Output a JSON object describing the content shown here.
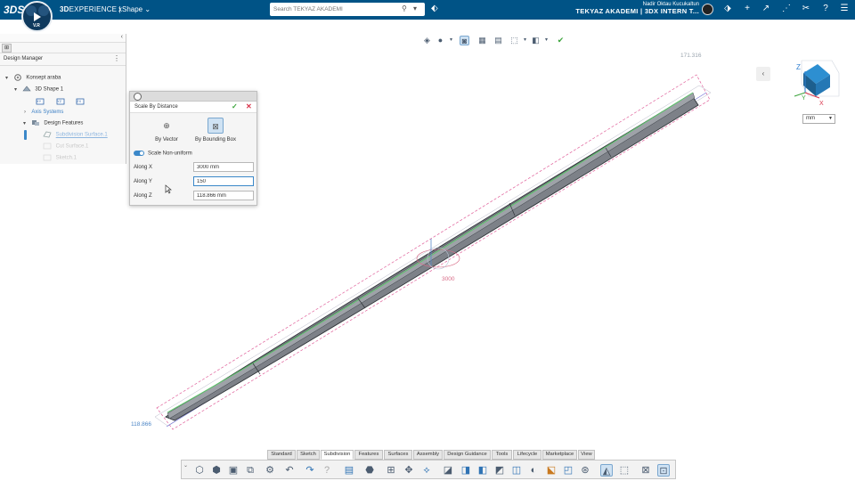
{
  "topbar": {
    "logo": "3DS",
    "brand_bold": "3D",
    "brand_rest": "EXPERIENCE",
    "app_separator": "|",
    "app_name": "xShape",
    "app_chevron": "⌄",
    "compass_version": "V.R",
    "search_placeholder": "Search TEKYAZ AKADEMI",
    "user_name": "Nadir Oktau Kucukaltun",
    "collab_space": "TEKYAZ AKADEMI | 3DX INTERN T...",
    "icons": [
      "tag-icon",
      "share-icon",
      "add-icon",
      "forward-icon",
      "network-icon",
      "tools-icon",
      "help-icon",
      "menu-icon"
    ]
  },
  "tree": {
    "collapse_glyph": "‹",
    "tab_glyph": "⊞",
    "header": "Design Manager",
    "more_glyph": "⋮",
    "nodes": [
      {
        "label": "Konsept araba",
        "caret": "▾"
      },
      {
        "label": "3D Shape 1",
        "caret": "▾"
      },
      {
        "label": "Axis Systems",
        "caret": "›"
      },
      {
        "label": "Design Features",
        "caret": "▾"
      },
      {
        "label": "Subdivision Surface.1",
        "caret": ""
      },
      {
        "label": "Cut Surface.1",
        "caret": ""
      },
      {
        "label": "Sketch.1",
        "caret": ""
      }
    ],
    "planes": [
      "XY",
      "YZ",
      "ZX"
    ]
  },
  "viewport": {
    "dim_top": "171.316",
    "dim_bottom": "118.866",
    "dim_mid": "3000",
    "unit": "mm",
    "unit_dd": "▼",
    "side_toggle_glyph": "‹",
    "quick_icons": [
      "view-icon",
      "render-icon",
      "dropdown-icon",
      "fit-icon",
      "section-icon",
      "select-icon",
      "dropdown-icon",
      "cube-icon",
      "dropdown-icon",
      "check-icon"
    ],
    "viewcube_axes": [
      "Z",
      "Y",
      "X"
    ],
    "colors": {
      "outline": "#3a3f46",
      "highlight": "#5cc36a",
      "bbox": "#e0609a",
      "axis": "#6b6fd6"
    }
  },
  "dialog": {
    "title": "Scale By Distance",
    "ok_glyph": "✓",
    "close_glyph": "✕",
    "modes": [
      {
        "label": "By Vector",
        "glyph": "⊕"
      },
      {
        "label": "By Bounding Box",
        "glyph": "⊠"
      }
    ],
    "toggle_label": "Scale Non-uniform",
    "fields": [
      {
        "label": "Along X",
        "value": "3000 mm"
      },
      {
        "label": "Along Y",
        "value": "150"
      },
      {
        "label": "Along Z",
        "value": "118.866 mm"
      }
    ]
  },
  "actionbar": {
    "grip": "⌄",
    "tabs": [
      "Standard",
      "Sketch",
      "Subdivision",
      "Features",
      "Surfaces",
      "Assembly",
      "Design Guidance",
      "Tools",
      "Lifecycle",
      "Marketplace",
      "View"
    ],
    "active_tab": "Subdivision",
    "buttons": [
      "⬡",
      "⬢",
      "▣",
      "⧉",
      "⚙",
      "↶",
      "↷",
      "?",
      "▤",
      "⬣",
      "⊞",
      "✥",
      "⟡",
      "◪",
      "◨",
      "◧",
      "◩",
      "◫",
      "◐",
      "⬕",
      "◰",
      "⊛",
      "◭",
      "⬚",
      "⊠"
    ]
  }
}
